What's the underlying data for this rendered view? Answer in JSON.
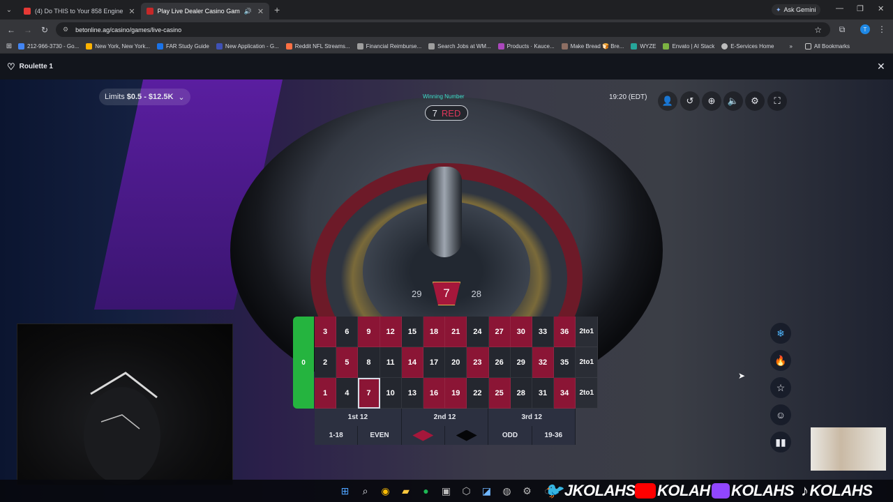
{
  "browser": {
    "tabs": [
      {
        "label": "(4) Do THIS to Your 858 Engine",
        "color": "#e53935"
      },
      {
        "label": "Play Live Dealer Casino Gam",
        "color": "#c62828"
      }
    ],
    "new_tab": "+",
    "ask_gemini": "Ask Gemini",
    "url": "betonline.ag/casino/games/live-casino",
    "bookmarks": [
      "212-966-3730 - Go...",
      "New York, New York...",
      "FAR Study Guide",
      "New Application - G...",
      "Reddit NFL Streams...",
      "Financial Reimburse...",
      "Search Jobs at WM...",
      "Products · Kauce...",
      "Make Bread 🍞 Bre...",
      "WYZE",
      "Envato | AI Stack",
      "E-Services Home"
    ],
    "all_bookmarks": "All Bookmarks",
    "more": "»"
  },
  "game": {
    "title": "Roulette 1",
    "limits_label": "Limits",
    "limits_value": "$0.5 - $12.5K",
    "winning_label": "Winning Number",
    "winning_number": "7",
    "winning_color": "RED",
    "clock": "19:20 (EDT)",
    "strip_left": "29",
    "strip_center": "7",
    "strip_right": "28",
    "zero": "0",
    "rows": [
      [
        "3",
        "6",
        "9",
        "12",
        "15",
        "18",
        "21",
        "24",
        "27",
        "30",
        "33",
        "36",
        "2to1"
      ],
      [
        "2",
        "5",
        "8",
        "11",
        "14",
        "17",
        "20",
        "23",
        "26",
        "29",
        "32",
        "35",
        "2to1"
      ],
      [
        "1",
        "4",
        "7",
        "10",
        "13",
        "16",
        "19",
        "22",
        "25",
        "28",
        "31",
        "34",
        "2to1"
      ]
    ],
    "dozens": [
      "1st 12",
      "2nd 12",
      "3rd 12"
    ],
    "outside": [
      "1-18",
      "EVEN",
      "",
      "",
      "ODD",
      "19-36"
    ],
    "red_numbers": [
      "1",
      "3",
      "5",
      "7",
      "9",
      "12",
      "14",
      "16",
      "18",
      "19",
      "21",
      "23",
      "25",
      "27",
      "30",
      "32",
      "34",
      "36"
    ],
    "highlighted": "7"
  },
  "overlay": {
    "handles": [
      "JKOLAHS",
      "KOLAH",
      "KOLAHS",
      "KOLAHS"
    ]
  },
  "colors": {
    "red": "#8b1535",
    "black": "#24272f",
    "green": "#25b43f",
    "accent": "#3de0c9"
  }
}
